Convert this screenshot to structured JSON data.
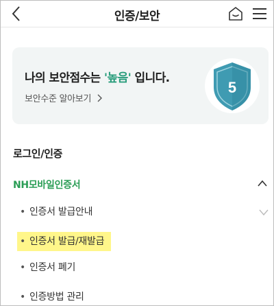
{
  "header": {
    "title": "인증/보안",
    "icons": {
      "back": "chevron-left-icon",
      "home": "home-icon",
      "menu": "hamburger-menu-icon"
    }
  },
  "score_card": {
    "title_prefix": "나의 보안점수는 ",
    "level": "'높음'",
    "title_suffix": " 입니다.",
    "link_label": "보안수준 알아보기",
    "shield_score": "5",
    "colors": {
      "shield": "#3f9bb2",
      "level": "#2a9d7c"
    }
  },
  "section": {
    "heading": "로그인/인증",
    "group": {
      "label": "NH모바일인증서",
      "color": "#2a9d55",
      "items": [
        {
          "label": "인증서 발급안내"
        },
        {
          "label": "인증서 발급/재발급"
        },
        {
          "label": "인증서 폐기"
        },
        {
          "label": "인증방법 관리"
        }
      ]
    }
  }
}
